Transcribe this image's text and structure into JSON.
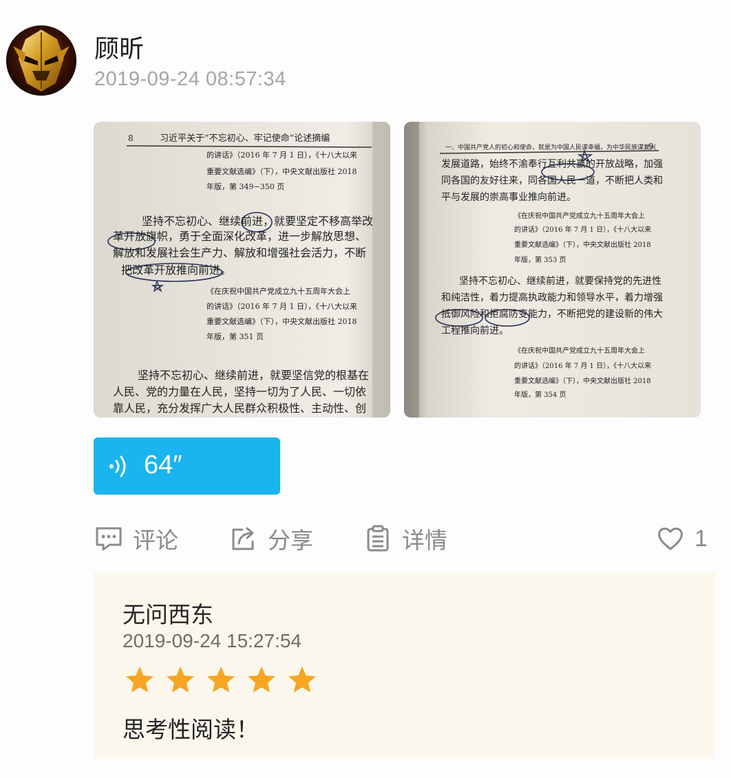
{
  "post": {
    "author": "顾昕",
    "timestamp": "2019-09-24 08:57:34",
    "images": [
      {
        "page_number": "8",
        "running_head": "习近平关于“不忘初心、牢记使命”论述摘编",
        "lines": [
          "的讲话》（2016 年 7 月 1 日），《十八大以来",
          "重要文献选编》（下），中央文献出版社 2018",
          "年版，第 349−350 页",
          "坚持不忘初心、继续前进，就要坚定不移高举改",
          "革开放旗帜，勇于全面深化改革，进一步解放思想、",
          "解放和发展社会生产力、解放和增强社会活力，不断",
          "把改革开放推向前进。",
          "《在庆祝中国共产党成立九十五周年大会上",
          "的讲话》（2016 年 7 月 1 日），《十八大以来",
          "重要文献选编》（下），中央文献出版社 2018",
          "年版，第 351 页",
          "坚持不忘初心、继续前进，就要坚信党的根基在",
          "人民、党的力量在人民，坚持一切为了人民、一切依",
          "靠人民，充分发挥广大人民群众积极性、主动性、创"
        ]
      },
      {
        "page_number": "9",
        "running_head": "一、中国共产党人的初心和使命，就是为中国人民谋幸福，为中华民族谋复兴",
        "lines": [
          "发展道路，始终不渝奉行互利共赢的开放战略，加强",
          "同各国的友好往来，同各国人民一道，不断把人类和",
          "平与发展的崇高事业推向前进。",
          "《在庆祝中国共产党成立九十五周年大会上",
          "的讲话》（2016 年 7 月 1 日），《十八大以来",
          "重要文献选编》（下），中央文献出版社 2018",
          "年版，第 353 页",
          "坚持不忘初心、继续前进，就要保持党的先进性",
          "和纯洁性，着力提高执政能力和领导水平，着力增强",
          "抵御风险和拒腐防变能力，不断把党的建设新的伟大",
          "工程推向前进。",
          "《在庆祝中国共产党成立九十五周年大会上",
          "的讲话》（2016 年 7 月 1 日），《十八大以来",
          "重要文献选编》（下），中央文献出版社 2018",
          "年版，第 354 页"
        ]
      }
    ],
    "voice": {
      "duration": "64″",
      "icon": "sound-wave-icon"
    },
    "actions": {
      "comment": {
        "label": "评论",
        "icon": "comment-icon"
      },
      "share": {
        "label": "分享",
        "icon": "share-icon"
      },
      "detail": {
        "label": "详情",
        "icon": "document-icon"
      },
      "like": {
        "count": "1",
        "icon": "heart-icon"
      }
    }
  },
  "comment": {
    "author": "无问西东",
    "timestamp": "2019-09-24 15:27:54",
    "rating": 5,
    "rating_max": 5,
    "text": "思考性阅读！"
  },
  "colors": {
    "voice_bg": "#1ab4ee",
    "star": "#f5a623",
    "comment_bg": "#fbf7ec",
    "muted_text": "#8a8a8a"
  }
}
